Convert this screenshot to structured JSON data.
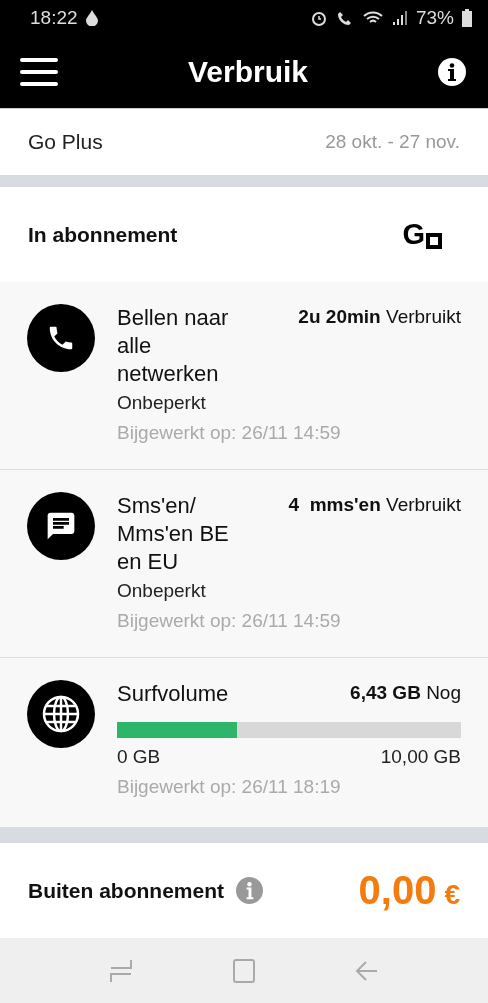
{
  "status_bar": {
    "time": "18:22",
    "battery": "73%"
  },
  "header": {
    "title": "Verbruik"
  },
  "plan": {
    "name": "Go Plus",
    "period": "28 okt. - 27 nov."
  },
  "section": {
    "title": "In abonnement",
    "logo_text": "G"
  },
  "items": [
    {
      "kind": "calls",
      "title": "Bellen naar alle netwerken",
      "value": "**2u 20min** Verbruikt",
      "limit": "Onbeperkt",
      "updated": "Bijgewerkt op: 26/11 14:59"
    },
    {
      "kind": "messages",
      "title": "Sms'en/ Mms'en BE en EU",
      "value": "**4  mms'en** Verbruikt",
      "limit": "Onbeperkt",
      "updated": "Bijgewerkt op: 26/11 14:59"
    },
    {
      "kind": "data",
      "title": "Surfvolume",
      "value": "**6,43 GB** Nog",
      "level": 0.35,
      "min": "0 GB",
      "max": "10,00 GB",
      "updated": "Bijgewerkt op: 26/11 18:19"
    }
  ],
  "outside": {
    "title": "Buiten abonnement",
    "amount": "0,00",
    "currency": "€"
  }
}
